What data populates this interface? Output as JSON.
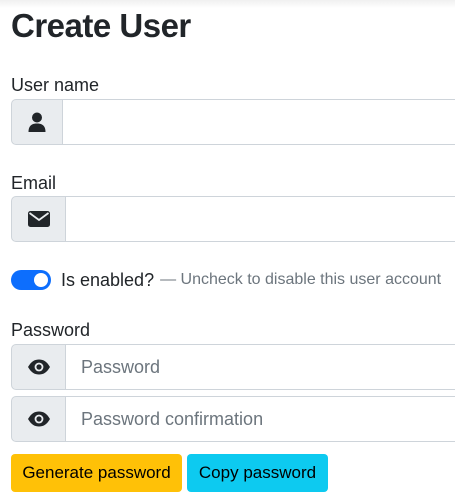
{
  "page": {
    "title": "Create User"
  },
  "username": {
    "label": "User name",
    "value": "",
    "placeholder": "",
    "icon": "user-icon"
  },
  "email": {
    "label": "Email",
    "value": "",
    "placeholder": "",
    "icon": "envelope-icon"
  },
  "enabled": {
    "label": "Is enabled?",
    "help": "— Uncheck to disable this user account",
    "checked": true,
    "accent_color": "#0d6efd"
  },
  "password": {
    "label": "Password",
    "placeholder": "Password",
    "confirmation_placeholder": "Password confirmation",
    "icon": "eye-icon"
  },
  "actions": {
    "generate_label": "Generate password",
    "generate_color": "#ffc107",
    "copy_label": "Copy password",
    "copy_color": "#0dcaf0"
  }
}
